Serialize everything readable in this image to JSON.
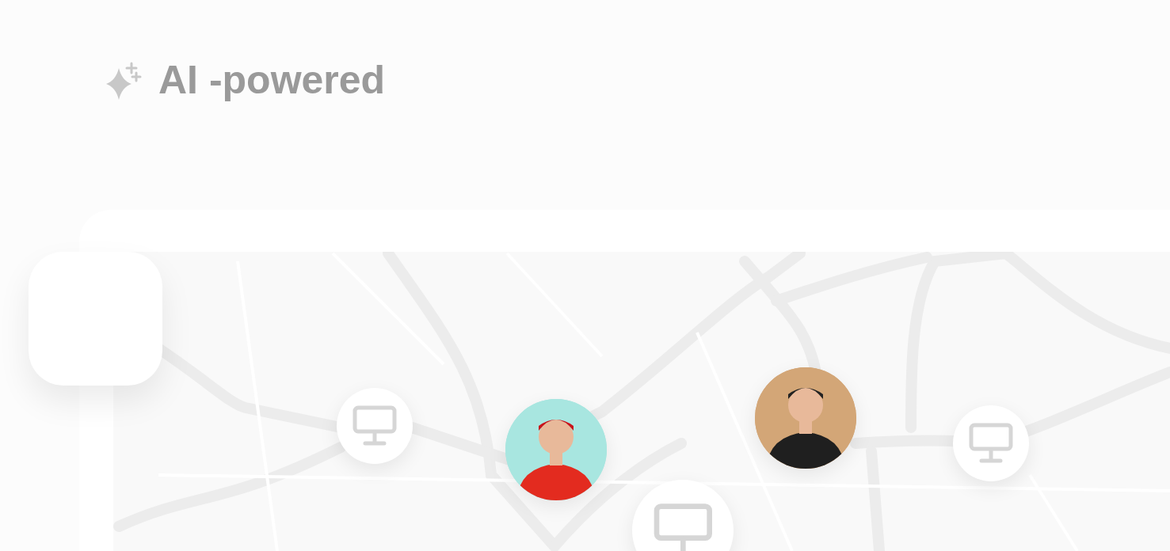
{
  "heading": {
    "text": "AI -powered"
  },
  "map": {
    "nodes": [
      {
        "kind": "device"
      },
      {
        "kind": "person"
      },
      {
        "kind": "device"
      },
      {
        "kind": "person"
      },
      {
        "kind": "device"
      }
    ]
  }
}
